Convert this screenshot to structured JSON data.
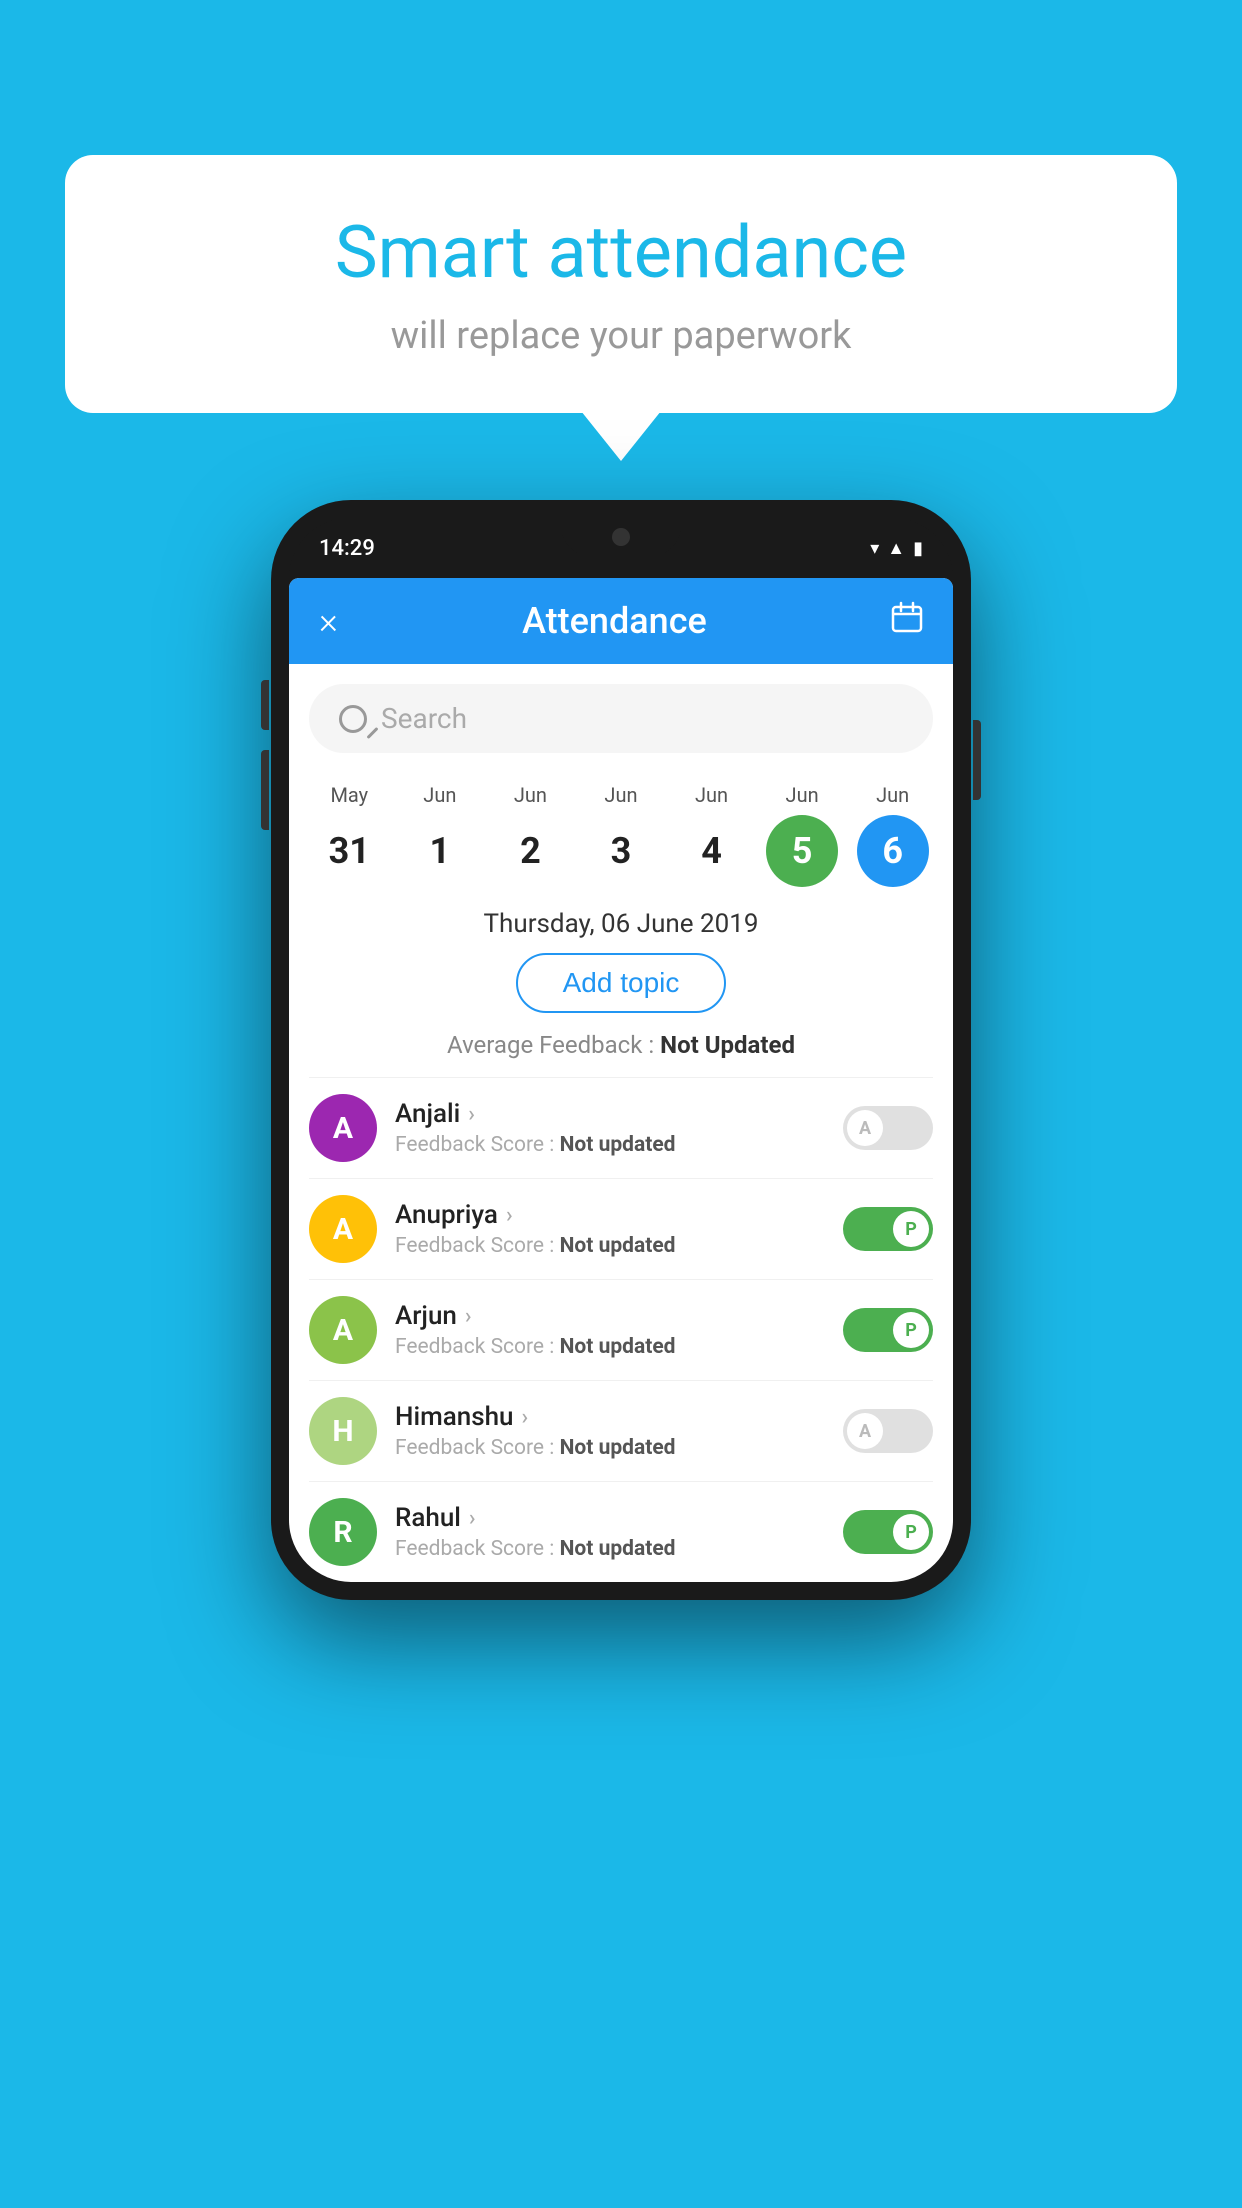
{
  "bubble": {
    "title": "Smart attendance",
    "subtitle": "will replace your paperwork"
  },
  "statusBar": {
    "time": "14:29",
    "icons": [
      "wifi",
      "signal",
      "battery"
    ]
  },
  "header": {
    "title": "Attendance",
    "close_label": "×",
    "calendar_label": "📅"
  },
  "search": {
    "placeholder": "Search"
  },
  "calendar": {
    "dates": [
      {
        "month": "May",
        "day": "31",
        "style": "normal"
      },
      {
        "month": "Jun",
        "day": "1",
        "style": "normal"
      },
      {
        "month": "Jun",
        "day": "2",
        "style": "normal"
      },
      {
        "month": "Jun",
        "day": "3",
        "style": "normal"
      },
      {
        "month": "Jun",
        "day": "4",
        "style": "normal"
      },
      {
        "month": "Jun",
        "day": "5",
        "style": "today"
      },
      {
        "month": "Jun",
        "day": "6",
        "style": "selected"
      }
    ],
    "selected_date": "Thursday, 06 June 2019"
  },
  "add_topic": {
    "label": "Add topic"
  },
  "avg_feedback": {
    "label": "Average Feedback : ",
    "value": "Not Updated"
  },
  "students": [
    {
      "name": "Anjali",
      "avatar_letter": "A",
      "avatar_color": "#9C27B0",
      "feedback": "Feedback Score : ",
      "feedback_value": "Not updated",
      "toggle": "off",
      "toggle_letter": "A"
    },
    {
      "name": "Anupriya",
      "avatar_letter": "A",
      "avatar_color": "#FFC107",
      "feedback": "Feedback Score : ",
      "feedback_value": "Not updated",
      "toggle": "on",
      "toggle_letter": "P"
    },
    {
      "name": "Arjun",
      "avatar_letter": "A",
      "avatar_color": "#8BC34A",
      "feedback": "Feedback Score : ",
      "feedback_value": "Not updated",
      "toggle": "on",
      "toggle_letter": "P"
    },
    {
      "name": "Himanshu",
      "avatar_letter": "H",
      "avatar_color": "#AED581",
      "feedback": "Feedback Score : ",
      "feedback_value": "Not updated",
      "toggle": "off",
      "toggle_letter": "A"
    },
    {
      "name": "Rahul",
      "avatar_letter": "R",
      "avatar_color": "#4CAF50",
      "feedback": "Feedback Score : ",
      "feedback_value": "Not updated",
      "toggle": "on",
      "toggle_letter": "P"
    }
  ]
}
